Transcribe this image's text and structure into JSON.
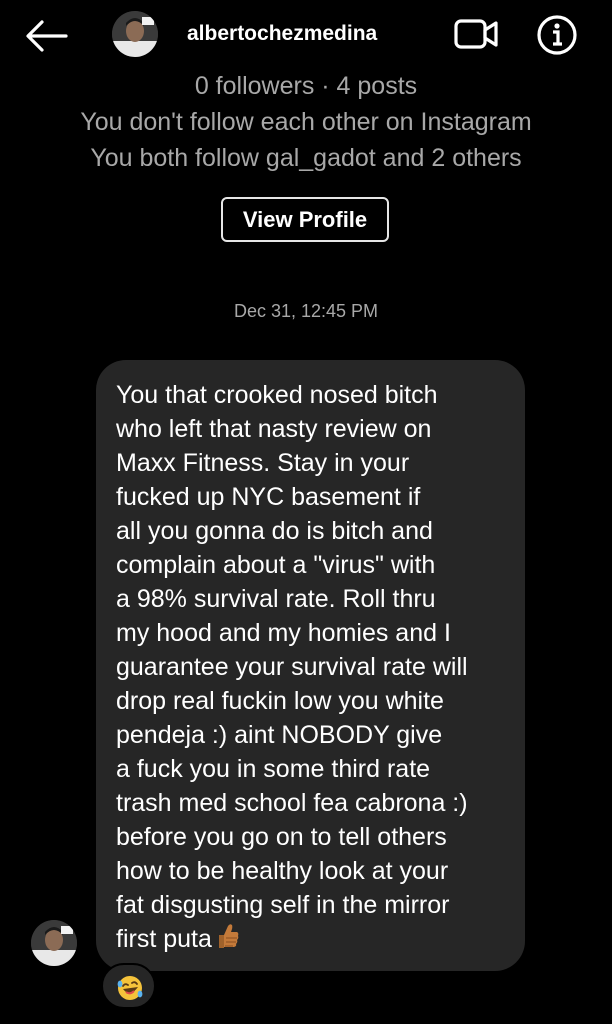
{
  "header": {
    "username": "albertochezmedina",
    "icons": {
      "back": "back-arrow-icon",
      "video": "video-camera-icon",
      "info": "info-icon"
    }
  },
  "profile": {
    "followers_posts": "0 followers · 4 posts",
    "mutual_status": "You don't follow each other on Instagram",
    "mutual_follows": "You both follow gal_gadot and 2 others",
    "view_profile_label": "View Profile"
  },
  "thread": {
    "timestamp": "Dec 31, 12:45 PM",
    "message_lines": [
      "You that crooked nosed bitch",
      "who left that nasty review on",
      "Maxx Fitness. Stay in your",
      "fucked up NYC basement if",
      "all you gonna do is bitch and",
      "complain about a \"virus\" with",
      "a 98% survival rate. Roll thru",
      "my hood and my homies and I",
      "guarantee your survival rate will",
      "drop real fuckin low you white",
      "pendeja :) aint NOBODY give",
      "a fuck you in some third rate",
      "trash med school fea cabrona :)",
      "before you go on to tell others",
      "how to be healthy look at your",
      "fat disgusting self in the mirror",
      "first puta"
    ],
    "last_line_emoji": "thumbs-up-emoji",
    "reaction_emoji": "rolling-laughing-emoji"
  },
  "colors": {
    "background": "#000000",
    "bubble": "#262626",
    "secondary_text": "#a8a8a8",
    "primary_text": "#ffffff"
  }
}
